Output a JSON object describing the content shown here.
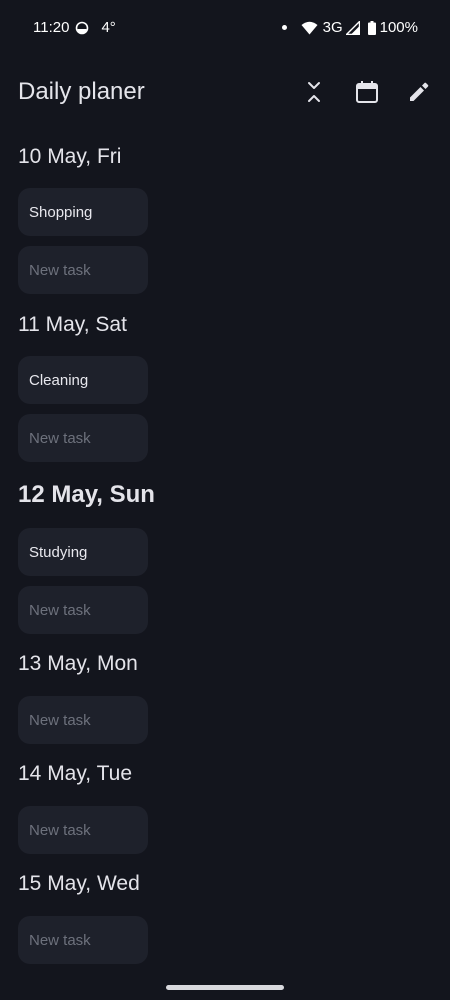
{
  "status_bar": {
    "time": "11:20",
    "temperature": "4°",
    "network": "3G",
    "battery": "100%",
    "icons": [
      "weather-icon",
      "notification-dot",
      "wifi-icon",
      "signal-icon",
      "battery-icon"
    ]
  },
  "app_bar": {
    "title": "Daily planer",
    "actions": [
      "collapse-icon",
      "calendar-icon",
      "edit-icon"
    ]
  },
  "days": [
    {
      "label": "10 May, Fri",
      "today": false,
      "tasks": [
        "Shopping"
      ],
      "new_task_placeholder": "New task"
    },
    {
      "label": "11 May, Sat",
      "today": false,
      "tasks": [
        "Cleaning"
      ],
      "new_task_placeholder": "New task"
    },
    {
      "label": "12 May, Sun",
      "today": true,
      "tasks": [
        "Studying"
      ],
      "new_task_placeholder": "New task"
    },
    {
      "label": "13 May, Mon",
      "today": false,
      "tasks": [],
      "new_task_placeholder": "New task"
    },
    {
      "label": "14 May, Tue",
      "today": false,
      "tasks": [],
      "new_task_placeholder": "New task"
    },
    {
      "label": "15 May, Wed",
      "today": false,
      "tasks": [],
      "new_task_placeholder": "New task"
    }
  ],
  "colors": {
    "background": "#13151d",
    "card": "#1e212b",
    "text": "#e4e4ea",
    "placeholder": "#6d717c"
  }
}
